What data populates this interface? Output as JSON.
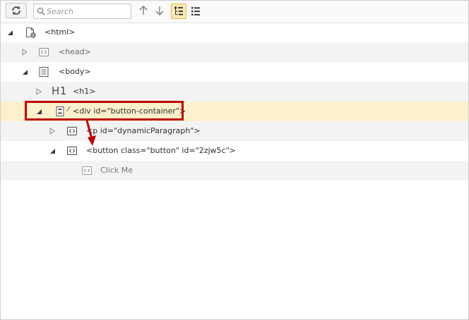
{
  "toolbar": {
    "search_placeholder": "Search"
  },
  "tree": {
    "html": "<html>",
    "head": "<head>",
    "body": "<body>",
    "h1_glyph": "H1",
    "h1": "<h1>",
    "div_prefix": "⁄",
    "div": "<div id=\"button-container\">",
    "p": "<p id=\"dynamicParagraph\">",
    "button": "<button class=\"button\" id=\"2zjw5c\">",
    "text_node": "Click Me"
  },
  "colors": {
    "highlight": "#c00000",
    "selected_row": "#fdf0cc",
    "alt_row": "#f3f3f3"
  }
}
